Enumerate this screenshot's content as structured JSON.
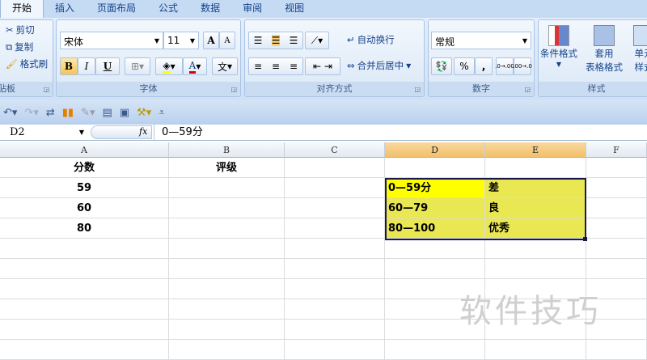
{
  "tabs": [
    "开始",
    "插入",
    "页面布局",
    "公式",
    "数据",
    "审阅",
    "视图"
  ],
  "clipboard": {
    "cut": "剪切",
    "copy": "复制",
    "format_painter": "格式刷",
    "label": "贴板"
  },
  "font": {
    "name": "宋体",
    "size": "11",
    "label": "字体",
    "bold": "B",
    "italic": "I",
    "underline": "U",
    "grow": "A",
    "shrink": "A",
    "color_letter": "A",
    "phonetic": "文"
  },
  "alignment": {
    "wrap": "自动换行",
    "merge": "合并后居中",
    "label": "对齐方式"
  },
  "number": {
    "format": "常规",
    "percent": "%",
    "comma": ",",
    "inc_decimal": ".0→.00",
    "dec_decimal": ".00→.0",
    "label": "数字"
  },
  "styles": {
    "conditional": "条件格式",
    "table_format_1": "套用",
    "table_format_2": "表格格式",
    "cell_styles_1": "单元",
    "cell_styles_2": "样式",
    "label": "样式"
  },
  "formula_bar": {
    "name_box": "D2",
    "fx": "fx",
    "content": "0—59分"
  },
  "columns": [
    "A",
    "B",
    "C",
    "D",
    "E",
    "F"
  ],
  "cells": {
    "A1": "分数",
    "B1": "评级",
    "A2": "59",
    "A3": "60",
    "A4": "80",
    "D2": "0—59分",
    "E2": "差",
    "D3": "60—79",
    "E3": "良",
    "D4": "80—100",
    "E4": "优秀"
  },
  "watermark": "软件技巧",
  "colors": {
    "fill": "#e9e752",
    "selected_cell_fill": "#ffff00",
    "selection_border": "#1a1a4a"
  }
}
